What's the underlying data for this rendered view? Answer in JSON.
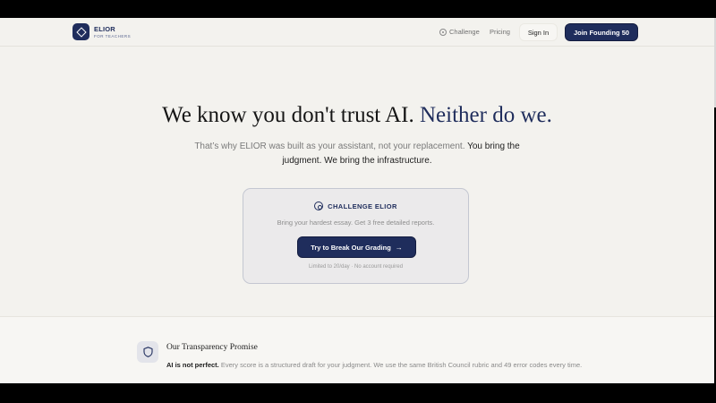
{
  "header": {
    "brand_name": "ELIOR",
    "brand_sub": "FOR TEACHERS",
    "nav_challenge": "Challenge",
    "nav_pricing": "Pricing",
    "signin_label": "Sign In",
    "join_label": "Join Founding 50"
  },
  "hero": {
    "title_part1": "We know you don't trust AI.",
    "title_part2": "Neither do we.",
    "sub_part1": "That’s why ELIOR was built as your assistant, not your replacement.",
    "sub_part2": "You bring the judgment. We bring the infrastructure."
  },
  "challenge_card": {
    "title": "CHALLENGE ELIOR",
    "description": "Bring your hardest essay. Get 3 free detailed reports.",
    "button_label": "Try to Break Our Grading",
    "note": "Limited to 20/day · No account required"
  },
  "transparency": {
    "title": "Our Transparency Promise",
    "lead": "AI is not perfect.",
    "body": "Every score is a structured draft for your judgment. We use the same British Council rubric and 49 error codes every time."
  },
  "icons": {
    "logo": "diamond-logo-icon",
    "challenge": "target-icon",
    "cta_arrow": "arrow-right-icon",
    "section": "shield-icon"
  },
  "colors": {
    "brand_navy": "#1f2d5c",
    "background": "#f3f2ee",
    "text_dark": "#151515",
    "text_muted": "#7a7a7a"
  }
}
